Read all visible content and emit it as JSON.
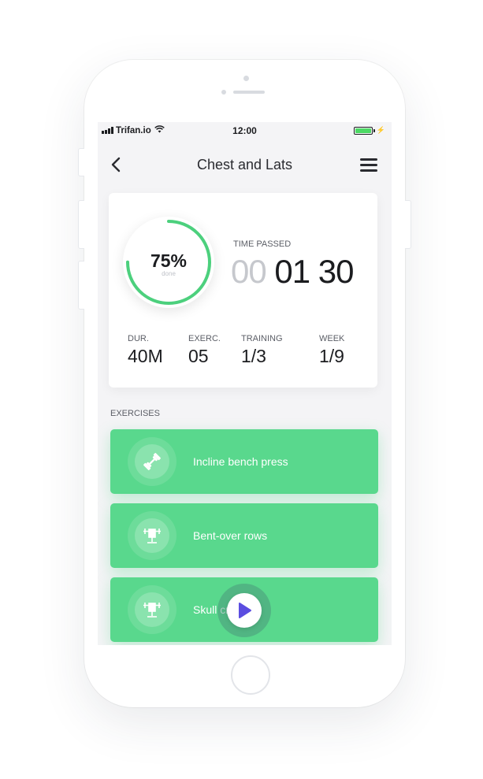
{
  "status_bar": {
    "carrier": "Trifan.io",
    "time": "12:00",
    "battery_color": "#4cd964"
  },
  "nav": {
    "back_icon": "chevron-left-icon",
    "title": "Chest and Lats",
    "menu_icon": "hamburger-menu-icon"
  },
  "summary": {
    "progress": {
      "percent_label": "75%",
      "percent_value": 0.75,
      "sub_label": "done",
      "accent": "#4cd07d"
    },
    "time": {
      "label": "TIME PASSED",
      "hours": "00",
      "minutes": "01",
      "seconds": "30"
    },
    "stats": [
      {
        "label": "DUR.",
        "value": "40M"
      },
      {
        "label": "EXERC.",
        "value": "05"
      },
      {
        "label": "TRAINING",
        "value": "1/3"
      },
      {
        "label": "WEEK",
        "value": "1/9"
      }
    ]
  },
  "exercises": {
    "label": "EXERCISES",
    "color": "#59d88d",
    "items": [
      {
        "name": "Incline bench press",
        "icon": "dumbbell-icon"
      },
      {
        "name": "Bent-over rows",
        "icon": "barbell-machine-icon"
      },
      {
        "name": "Skull cr",
        "icon": "barbell-machine-icon"
      }
    ]
  },
  "play": {
    "icon": "play-icon",
    "color": "#5b4de0"
  }
}
